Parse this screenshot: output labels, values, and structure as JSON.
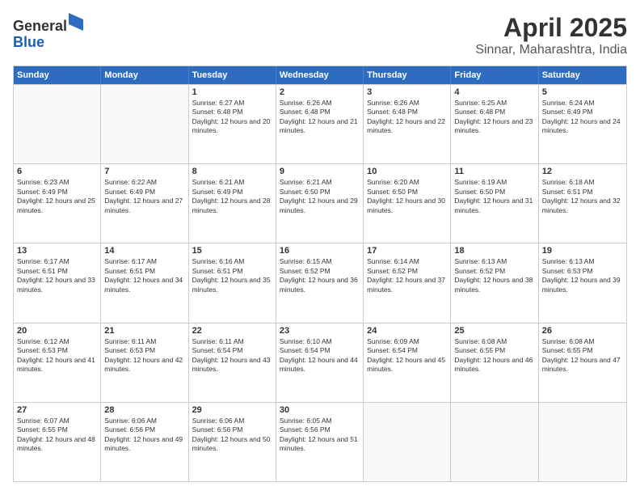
{
  "header": {
    "logo_line1": "General",
    "logo_line2": "Blue",
    "month": "April 2025",
    "location": "Sinnar, Maharashtra, India"
  },
  "days_of_week": [
    "Sunday",
    "Monday",
    "Tuesday",
    "Wednesday",
    "Thursday",
    "Friday",
    "Saturday"
  ],
  "weeks": [
    [
      {
        "day": "",
        "sunrise": "",
        "sunset": "",
        "daylight": ""
      },
      {
        "day": "",
        "sunrise": "",
        "sunset": "",
        "daylight": ""
      },
      {
        "day": "1",
        "sunrise": "Sunrise: 6:27 AM",
        "sunset": "Sunset: 6:48 PM",
        "daylight": "Daylight: 12 hours and 20 minutes."
      },
      {
        "day": "2",
        "sunrise": "Sunrise: 6:26 AM",
        "sunset": "Sunset: 6:48 PM",
        "daylight": "Daylight: 12 hours and 21 minutes."
      },
      {
        "day": "3",
        "sunrise": "Sunrise: 6:26 AM",
        "sunset": "Sunset: 6:48 PM",
        "daylight": "Daylight: 12 hours and 22 minutes."
      },
      {
        "day": "4",
        "sunrise": "Sunrise: 6:25 AM",
        "sunset": "Sunset: 6:48 PM",
        "daylight": "Daylight: 12 hours and 23 minutes."
      },
      {
        "day": "5",
        "sunrise": "Sunrise: 6:24 AM",
        "sunset": "Sunset: 6:49 PM",
        "daylight": "Daylight: 12 hours and 24 minutes."
      }
    ],
    [
      {
        "day": "6",
        "sunrise": "Sunrise: 6:23 AM",
        "sunset": "Sunset: 6:49 PM",
        "daylight": "Daylight: 12 hours and 25 minutes."
      },
      {
        "day": "7",
        "sunrise": "Sunrise: 6:22 AM",
        "sunset": "Sunset: 6:49 PM",
        "daylight": "Daylight: 12 hours and 27 minutes."
      },
      {
        "day": "8",
        "sunrise": "Sunrise: 6:21 AM",
        "sunset": "Sunset: 6:49 PM",
        "daylight": "Daylight: 12 hours and 28 minutes."
      },
      {
        "day": "9",
        "sunrise": "Sunrise: 6:21 AM",
        "sunset": "Sunset: 6:50 PM",
        "daylight": "Daylight: 12 hours and 29 minutes."
      },
      {
        "day": "10",
        "sunrise": "Sunrise: 6:20 AM",
        "sunset": "Sunset: 6:50 PM",
        "daylight": "Daylight: 12 hours and 30 minutes."
      },
      {
        "day": "11",
        "sunrise": "Sunrise: 6:19 AM",
        "sunset": "Sunset: 6:50 PM",
        "daylight": "Daylight: 12 hours and 31 minutes."
      },
      {
        "day": "12",
        "sunrise": "Sunrise: 6:18 AM",
        "sunset": "Sunset: 6:51 PM",
        "daylight": "Daylight: 12 hours and 32 minutes."
      }
    ],
    [
      {
        "day": "13",
        "sunrise": "Sunrise: 6:17 AM",
        "sunset": "Sunset: 6:51 PM",
        "daylight": "Daylight: 12 hours and 33 minutes."
      },
      {
        "day": "14",
        "sunrise": "Sunrise: 6:17 AM",
        "sunset": "Sunset: 6:51 PM",
        "daylight": "Daylight: 12 hours and 34 minutes."
      },
      {
        "day": "15",
        "sunrise": "Sunrise: 6:16 AM",
        "sunset": "Sunset: 6:51 PM",
        "daylight": "Daylight: 12 hours and 35 minutes."
      },
      {
        "day": "16",
        "sunrise": "Sunrise: 6:15 AM",
        "sunset": "Sunset: 6:52 PM",
        "daylight": "Daylight: 12 hours and 36 minutes."
      },
      {
        "day": "17",
        "sunrise": "Sunrise: 6:14 AM",
        "sunset": "Sunset: 6:52 PM",
        "daylight": "Daylight: 12 hours and 37 minutes."
      },
      {
        "day": "18",
        "sunrise": "Sunrise: 6:13 AM",
        "sunset": "Sunset: 6:52 PM",
        "daylight": "Daylight: 12 hours and 38 minutes."
      },
      {
        "day": "19",
        "sunrise": "Sunrise: 6:13 AM",
        "sunset": "Sunset: 6:53 PM",
        "daylight": "Daylight: 12 hours and 39 minutes."
      }
    ],
    [
      {
        "day": "20",
        "sunrise": "Sunrise: 6:12 AM",
        "sunset": "Sunset: 6:53 PM",
        "daylight": "Daylight: 12 hours and 41 minutes."
      },
      {
        "day": "21",
        "sunrise": "Sunrise: 6:11 AM",
        "sunset": "Sunset: 6:53 PM",
        "daylight": "Daylight: 12 hours and 42 minutes."
      },
      {
        "day": "22",
        "sunrise": "Sunrise: 6:11 AM",
        "sunset": "Sunset: 6:54 PM",
        "daylight": "Daylight: 12 hours and 43 minutes."
      },
      {
        "day": "23",
        "sunrise": "Sunrise: 6:10 AM",
        "sunset": "Sunset: 6:54 PM",
        "daylight": "Daylight: 12 hours and 44 minutes."
      },
      {
        "day": "24",
        "sunrise": "Sunrise: 6:09 AM",
        "sunset": "Sunset: 6:54 PM",
        "daylight": "Daylight: 12 hours and 45 minutes."
      },
      {
        "day": "25",
        "sunrise": "Sunrise: 6:08 AM",
        "sunset": "Sunset: 6:55 PM",
        "daylight": "Daylight: 12 hours and 46 minutes."
      },
      {
        "day": "26",
        "sunrise": "Sunrise: 6:08 AM",
        "sunset": "Sunset: 6:55 PM",
        "daylight": "Daylight: 12 hours and 47 minutes."
      }
    ],
    [
      {
        "day": "27",
        "sunrise": "Sunrise: 6:07 AM",
        "sunset": "Sunset: 6:55 PM",
        "daylight": "Daylight: 12 hours and 48 minutes."
      },
      {
        "day": "28",
        "sunrise": "Sunrise: 6:06 AM",
        "sunset": "Sunset: 6:56 PM",
        "daylight": "Daylight: 12 hours and 49 minutes."
      },
      {
        "day": "29",
        "sunrise": "Sunrise: 6:06 AM",
        "sunset": "Sunset: 6:56 PM",
        "daylight": "Daylight: 12 hours and 50 minutes."
      },
      {
        "day": "30",
        "sunrise": "Sunrise: 6:05 AM",
        "sunset": "Sunset: 6:56 PM",
        "daylight": "Daylight: 12 hours and 51 minutes."
      },
      {
        "day": "",
        "sunrise": "",
        "sunset": "",
        "daylight": ""
      },
      {
        "day": "",
        "sunrise": "",
        "sunset": "",
        "daylight": ""
      },
      {
        "day": "",
        "sunrise": "",
        "sunset": "",
        "daylight": ""
      }
    ]
  ]
}
